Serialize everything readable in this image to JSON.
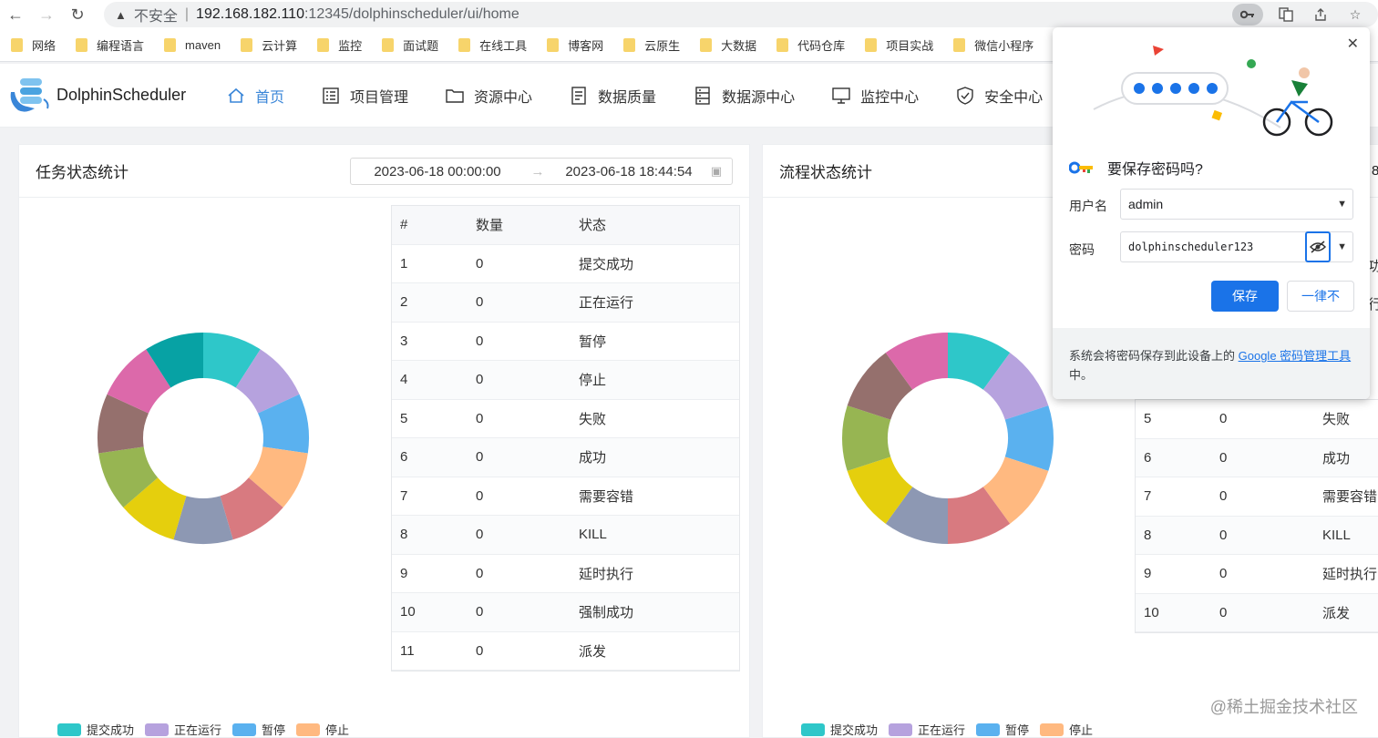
{
  "browser": {
    "insecure_label": "不安全",
    "url_host": "192.168.182.110",
    "url_path": ":12345/dolphinscheduler/ui/home"
  },
  "bookmarks": [
    "网络",
    "编程语言",
    "maven",
    "云计算",
    "监控",
    "面试题",
    "在线工具",
    "博客网",
    "云原生",
    "大数据",
    "代码仓库",
    "项目实战",
    "微信小程序"
  ],
  "app": {
    "name": "DolphinScheduler",
    "menu": [
      {
        "label": "首页",
        "icon": "home-icon",
        "active": true
      },
      {
        "label": "项目管理",
        "icon": "list-icon",
        "active": false
      },
      {
        "label": "资源中心",
        "icon": "folder-icon",
        "active": false
      },
      {
        "label": "数据质量",
        "icon": "document-icon",
        "active": false
      },
      {
        "label": "数据源中心",
        "icon": "server-icon",
        "active": false
      },
      {
        "label": "监控中心",
        "icon": "monitor-icon",
        "active": false
      },
      {
        "label": "安全中心",
        "icon": "shield-icon",
        "active": false
      }
    ]
  },
  "task_card": {
    "title": "任务状态统计",
    "date_start": "2023-06-18 00:00:00",
    "date_end": "2023-06-18 18:44:54",
    "table_headers": [
      "#",
      "数量",
      "状态"
    ],
    "rows": [
      [
        "1",
        "0",
        "提交成功"
      ],
      [
        "2",
        "0",
        "正在运行"
      ],
      [
        "3",
        "0",
        "暂停"
      ],
      [
        "4",
        "0",
        "停止"
      ],
      [
        "5",
        "0",
        "失败"
      ],
      [
        "6",
        "0",
        "成功"
      ],
      [
        "7",
        "0",
        "需要容错"
      ],
      [
        "8",
        "0",
        "KILL"
      ],
      [
        "9",
        "0",
        "延时执行"
      ],
      [
        "10",
        "0",
        "强制成功"
      ],
      [
        "11",
        "0",
        "派发"
      ]
    ]
  },
  "process_card": {
    "title": "流程状态统计",
    "date_fragment": "8",
    "visible_rows": [
      [
        "5",
        "0",
        "失败"
      ],
      [
        "6",
        "0",
        "成功"
      ],
      [
        "7",
        "0",
        "需要容错"
      ],
      [
        "8",
        "0",
        "KILL"
      ],
      [
        "9",
        "0",
        "延时执行"
      ],
      [
        "10",
        "0",
        "派发"
      ]
    ],
    "hidden_col_fragments": [
      "功",
      "行"
    ]
  },
  "legend": [
    {
      "label": "提交成功",
      "color": "#2ec7c9"
    },
    {
      "label": "正在运行",
      "color": "#b6a2de"
    },
    {
      "label": "暂停",
      "color": "#5ab1ef"
    },
    {
      "label": "停止",
      "color": "#ffb980"
    }
  ],
  "donut_task": {
    "colors": [
      "#2ec7c9",
      "#b6a2de",
      "#5ab1ef",
      "#ffb980",
      "#d87a80",
      "#8d98b3",
      "#e5cf0d",
      "#97b552",
      "#95706d",
      "#dc69aa",
      "#07a2a4"
    ],
    "values": [
      1,
      1,
      1,
      1,
      1,
      1,
      1,
      1,
      1,
      1,
      1
    ]
  },
  "donut_process": {
    "colors": [
      "#2ec7c9",
      "#b6a2de",
      "#5ab1ef",
      "#ffb980",
      "#d87a80",
      "#8d98b3",
      "#e5cf0d",
      "#97b552",
      "#95706d",
      "#dc69aa"
    ],
    "values": [
      1,
      1,
      1,
      1,
      1,
      1,
      1,
      1,
      1,
      1
    ]
  },
  "password_popup": {
    "title": "要保存密码吗?",
    "username_label": "用户名",
    "username_value": "admin",
    "password_label": "密码",
    "password_value": "dolphinscheduler123",
    "save_label": "保存",
    "never_label": "一律不",
    "footer_text": "系统会将密码保存到此设备上的 ",
    "footer_link": "Google 密码管理工具",
    "footer_end": "中。"
  },
  "watermark": "@稀土掘金技术社区"
}
